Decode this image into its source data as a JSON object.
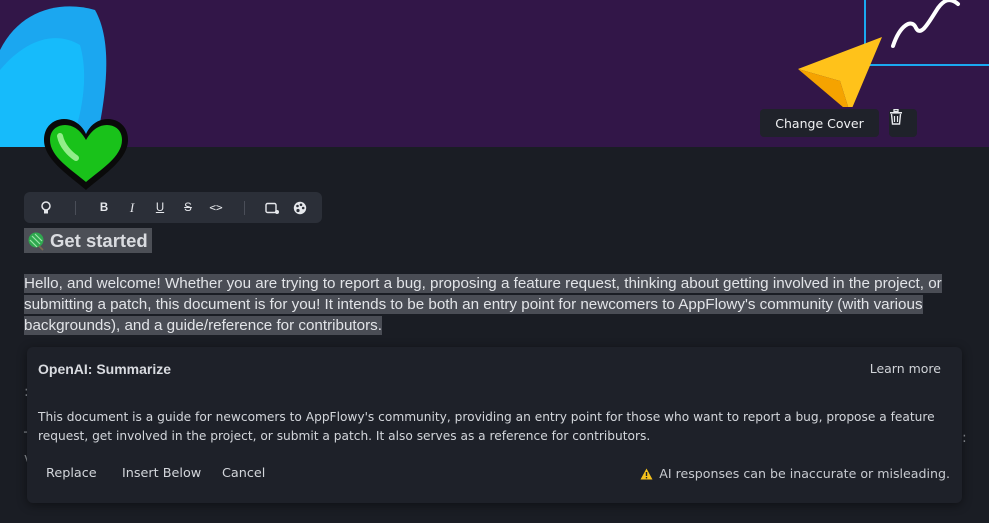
{
  "cover": {
    "change_cover_label": "Change Cover",
    "background_color": "#321648"
  },
  "toolbar": {
    "items": [
      "lightbulb-icon",
      "B",
      "I",
      "U",
      "S",
      "<>",
      "image-add-icon",
      "palette-icon"
    ]
  },
  "heading": {
    "emoji": "balloon-icon",
    "text": "Get started"
  },
  "paragraph": {
    "text": "Hello, and welcome! Whether you are trying to report a bug, proposing a feature request, thinking about getting involved in the project, or submitting a patch, this document is for you! It intends to be both an entry point for newcomers to AppFlowy's community (with various backgrounds), and a guide/reference for contributors."
  },
  "ai_panel": {
    "title": "OpenAI: Summarize",
    "learn_more": "Learn more",
    "summary": "This document is a guide for newcomers to AppFlowy's community, providing an entry point for those who want to report a bug, propose a feature request, get involved in the project, or submit a patch. It also serves as a reference for contributors.",
    "actions": {
      "replace": "Replace",
      "insert_below": "Insert Below",
      "cancel": "Cancel"
    },
    "warning": "AI responses can be inaccurate or misleading."
  }
}
